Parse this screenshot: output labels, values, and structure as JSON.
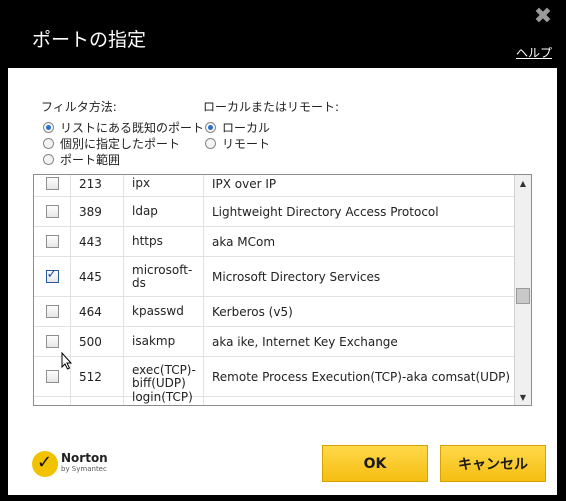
{
  "dialog": {
    "title": "ポートの指定",
    "close_icon": "close-icon",
    "help_label": "ヘルプ"
  },
  "filter": {
    "label": "フィルタ方法:",
    "options": [
      {
        "label": "リストにある既知のポート",
        "selected": true
      },
      {
        "label": "個別に指定したポート",
        "selected": false
      },
      {
        "label": "ポート範囲",
        "selected": false
      }
    ]
  },
  "scope": {
    "label": "ローカルまたはリモート:",
    "options": [
      {
        "label": "ローカル",
        "selected": true
      },
      {
        "label": "リモート",
        "selected": false
      }
    ]
  },
  "ports": [
    {
      "checked": false,
      "port": "213",
      "name": "ipx",
      "description": "IPX over IP"
    },
    {
      "checked": false,
      "port": "389",
      "name": "ldap",
      "description": "Lightweight Directory Access Protocol"
    },
    {
      "checked": false,
      "port": "443",
      "name": "https",
      "description": "aka MCom"
    },
    {
      "checked": true,
      "port": "445",
      "name": "microsoft-ds",
      "description": "Microsoft Directory Services"
    },
    {
      "checked": false,
      "port": "464",
      "name": "kpasswd",
      "description": "Kerberos (v5)"
    },
    {
      "checked": false,
      "port": "500",
      "name": "isakmp",
      "description": "aka ike, Internet Key Exchange"
    },
    {
      "checked": false,
      "port": "512",
      "name": "exec(TCP)-biff(UDP)",
      "description": "Remote Process Execution(TCP)-aka comsat(UDP)"
    },
    {
      "checked": false,
      "port": "",
      "name": "login(TCP)",
      "description": ""
    }
  ],
  "logo": {
    "name": "Norton",
    "sub": "by Symantec"
  },
  "buttons": {
    "ok": "OK",
    "cancel": "キャンセル"
  },
  "colors": {
    "accent": "#f5be12",
    "frame": "#000000"
  }
}
